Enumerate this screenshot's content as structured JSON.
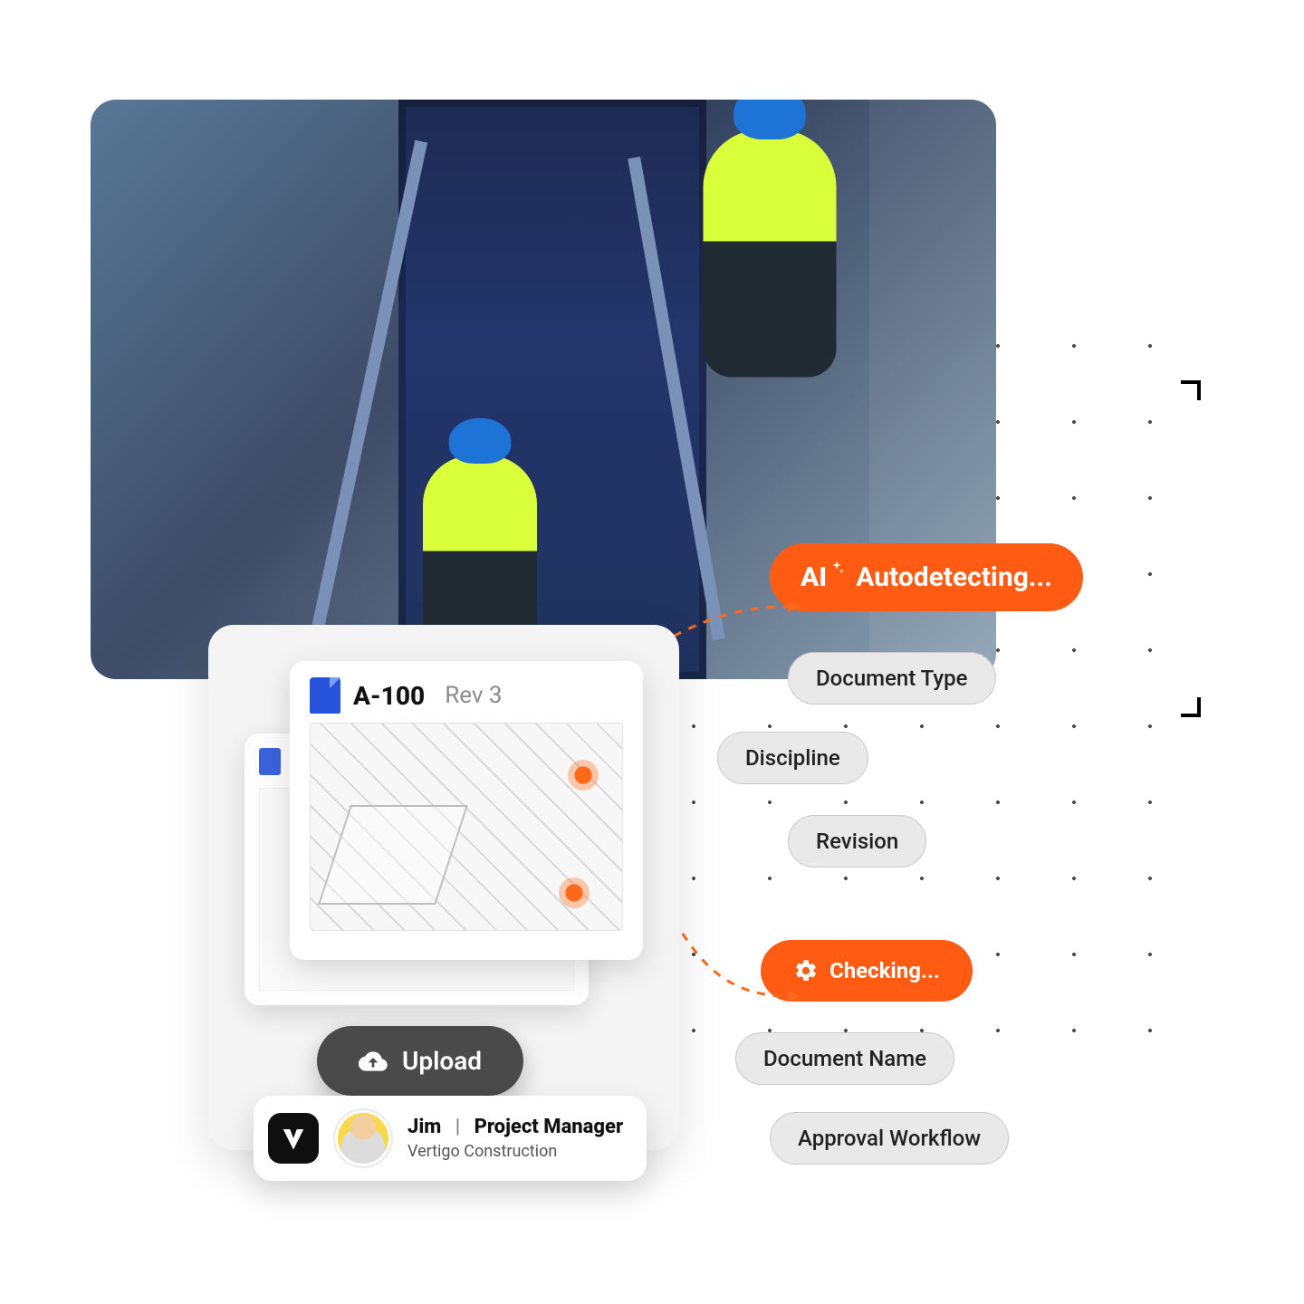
{
  "hero": {
    "alt": "Construction workers on scaffolding"
  },
  "badges": {
    "autodetect": {
      "prefix": "AI",
      "label": "Autodetecting..."
    },
    "checking": {
      "label": "Checking..."
    }
  },
  "tags": {
    "doc_type": "Document Type",
    "discipline": "Discipline",
    "revision": "Revision",
    "doc_name": "Document Name",
    "approval": "Approval Workflow"
  },
  "document": {
    "code": "A-100",
    "revision": "Rev 3"
  },
  "upload": {
    "label": "Upload"
  },
  "user": {
    "name": "Jim",
    "role": "Project Manager",
    "company": "Vertigo Construction",
    "separator": "|"
  }
}
